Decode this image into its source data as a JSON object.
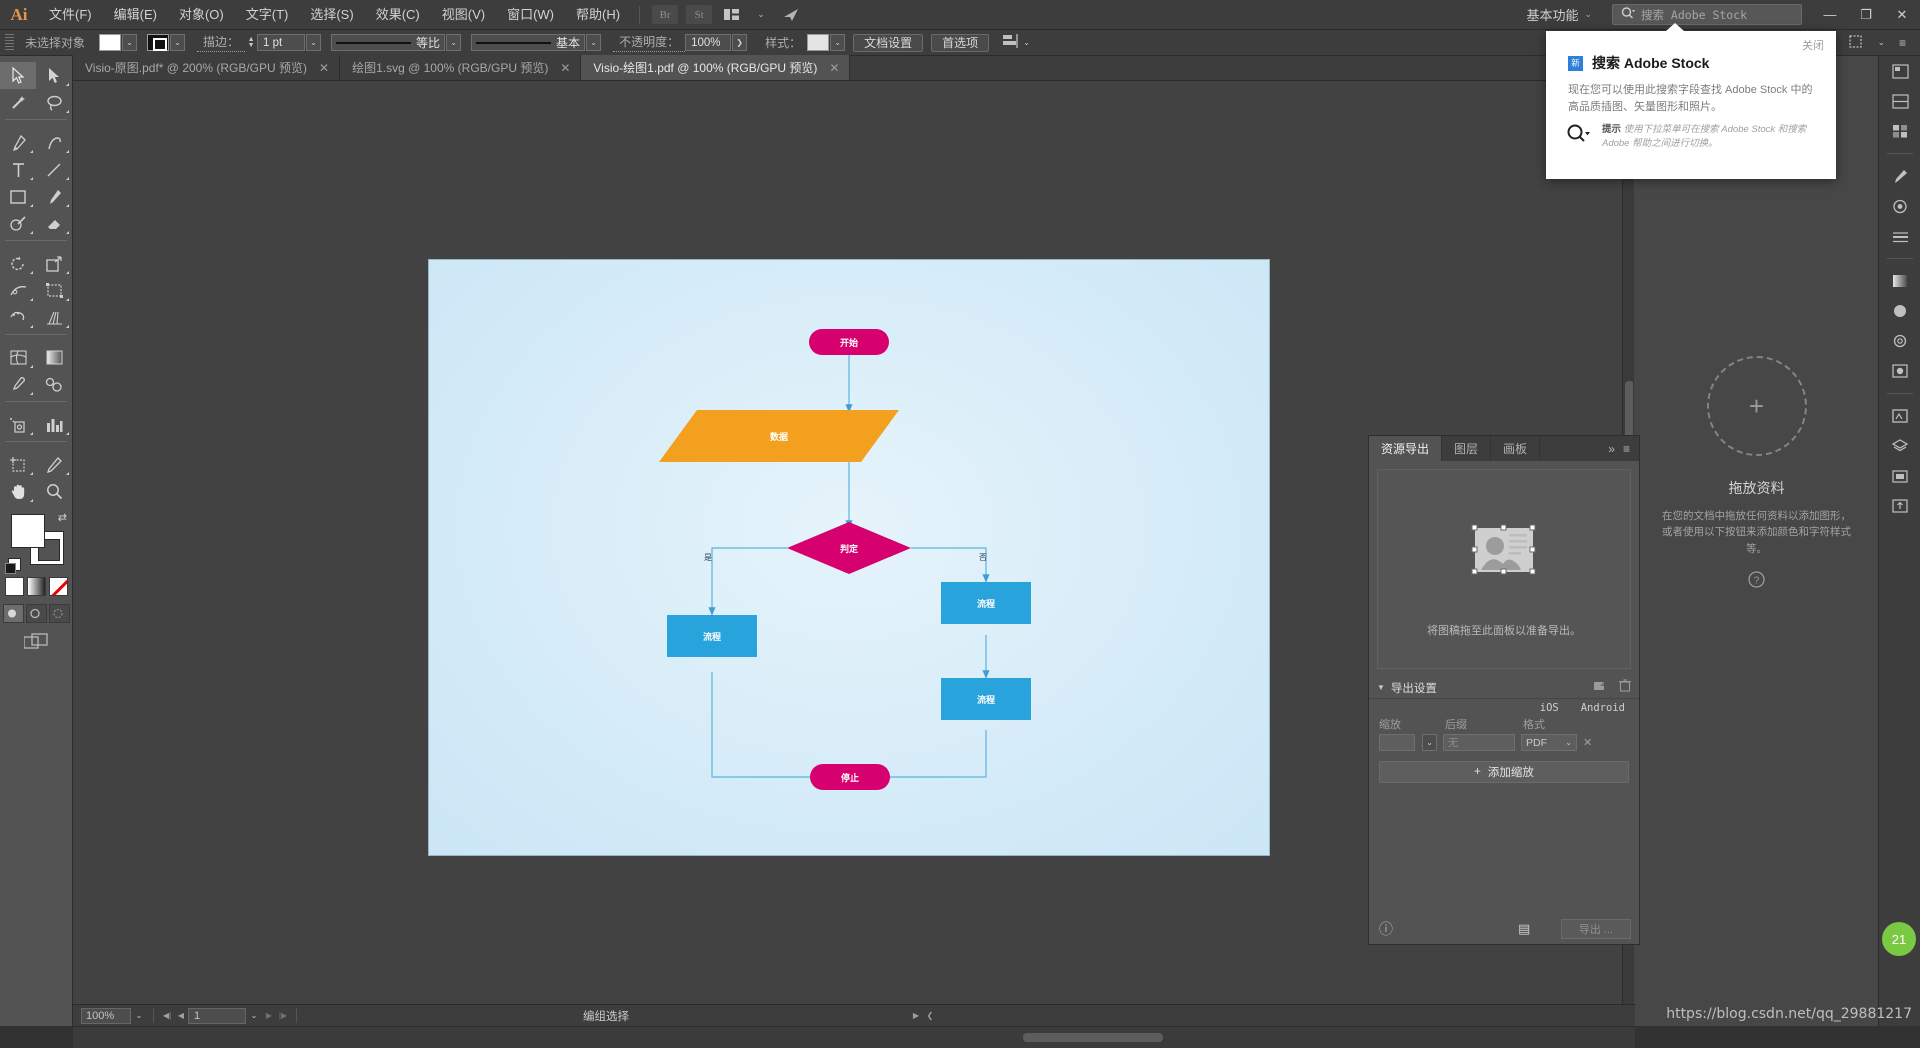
{
  "app": {
    "logo": "Ai",
    "title": "Adobe Illustrator"
  },
  "menubar": {
    "items": [
      {
        "label": "文件(F)"
      },
      {
        "label": "编辑(E)"
      },
      {
        "label": "对象(O)"
      },
      {
        "label": "文字(T)"
      },
      {
        "label": "选择(S)"
      },
      {
        "label": "效果(C)"
      },
      {
        "label": "视图(V)"
      },
      {
        "label": "窗口(W)"
      },
      {
        "label": "帮助(H)"
      }
    ],
    "bridge_label": "Br",
    "stock_label": "St",
    "workspace": "基本功能",
    "workspace_caret": "⌄",
    "stock_search_placeholder": "搜索 Adobe Stock",
    "window_minimize": "—",
    "window_restore": "❐",
    "window_close": "✕"
  },
  "controlbar": {
    "selection_status": "未选择对象",
    "stroke_label": "描边：",
    "stroke_width": "1 pt",
    "variable_width_profile": "等比",
    "brush_definition": "基本",
    "opacity_label": "不透明度：",
    "opacity_value": "100%",
    "opacity_arrow": "❯",
    "style_label": "样式：",
    "document_setup": "文档设置",
    "preferences": "首选项",
    "align_caret": "⌄"
  },
  "tabs": [
    {
      "label": "Visio-原图.pdf* @ 200% (RGB/GPU 预览)",
      "active": false,
      "close": "✕"
    },
    {
      "label": "绘图1.svg @ 100% (RGB/GPU 预览)",
      "active": false,
      "close": "✕"
    },
    {
      "label": "Visio-绘图1.pdf @ 100% (RGB/GPU 预览)",
      "active": true,
      "close": "✕"
    }
  ],
  "toolbar": {
    "tools": [
      "selection-tool",
      "direct-selection-tool",
      "magic-wand-tool",
      "lasso-tool",
      "pen-tool",
      "curvature-tool",
      "type-tool",
      "line-segment-tool",
      "rectangle-tool",
      "paintbrush-tool",
      "shape-builder-tool",
      "eraser-tool",
      "rotate-tool",
      "scale-tool",
      "width-tool",
      "free-transform-tool",
      "puppet-warp-tool",
      "perspective-grid-tool",
      "mesh-tool",
      "gradient-tool",
      "eyedropper-tool",
      "blend-tool",
      "symbol-sprayer-tool",
      "column-graph-tool",
      "artboard-tool",
      "slice-tool",
      "hand-tool",
      "zoom-tool"
    ],
    "fill_color": "#ffffff",
    "stroke_color": "#ffffff",
    "swap_icon": "⇄",
    "modes": [
      "color-mode",
      "gradient-mode",
      "none-mode"
    ],
    "draw_modes": [
      "draw-normal",
      "draw-behind",
      "draw-inside"
    ],
    "screen_mode": "change-screen-mode"
  },
  "canvas": {
    "artboard_bg": "#d9eef9",
    "flowchart": {
      "nodes": [
        {
          "id": "start",
          "label": "开始",
          "type": "terminator",
          "color": "#d6006f"
        },
        {
          "id": "data",
          "label": "数据",
          "type": "data",
          "color": "#f2a01e"
        },
        {
          "id": "decision",
          "label": "判定",
          "type": "decision",
          "color": "#d6006f"
        },
        {
          "id": "proc_yes",
          "label": "流程",
          "type": "process",
          "color": "#29a3dc"
        },
        {
          "id": "proc_no1",
          "label": "流程",
          "type": "process",
          "color": "#29a3dc"
        },
        {
          "id": "proc_no2",
          "label": "流程",
          "type": "process",
          "color": "#29a3dc"
        },
        {
          "id": "stop",
          "label": "停止",
          "type": "terminator",
          "color": "#d6006f"
        }
      ],
      "edge_labels": [
        {
          "id": "yes",
          "label": "是"
        },
        {
          "id": "no",
          "label": "否"
        }
      ],
      "connector_color": "#4aa8d8"
    }
  },
  "right_dock": {
    "icons": [
      "color-panel",
      "color-guide-panel",
      "swatches-panel",
      "brushes-panel",
      "symbols-panel",
      "stroke-panel",
      "gradient-panel",
      "transparency-panel",
      "appearance-panel",
      "graphic-styles-panel",
      "align-panel",
      "pathfinder-panel",
      "transform-panel",
      "libraries-panel",
      "layers-panel",
      "artboards-panel",
      "asset-export-panel"
    ],
    "drop_zone": {
      "title": "拖放资料",
      "description": "在您的文档中拖放任何资料以添加图形，或者使用以下按钮来添加颜色和字符样式等。",
      "plus": "+",
      "help": "?"
    }
  },
  "asset_export": {
    "tabs": [
      {
        "label": "资源导出",
        "active": true
      },
      {
        "label": "图层",
        "active": false
      },
      {
        "label": "画板",
        "active": false
      }
    ],
    "expand_icon": "»",
    "menu_icon": "≡",
    "drop_hint": "将图稿拖至此面板以准备导出。",
    "settings_title": "导出设置",
    "settings_arrow": "▼",
    "preset_ios": "iOS",
    "preset_android": "Android",
    "col_scale": "缩放",
    "col_suffix": "后缀",
    "col_format": "格式",
    "suffix_value": "无",
    "format_value": "PDF",
    "remove_icon": "✕",
    "add_scale": "添加缩放",
    "add_scale_plus": "+",
    "info_icon": "ⓘ",
    "list_icon": "▤",
    "export_button": "导出 ..."
  },
  "stock_popup": {
    "close": "关闭",
    "badge": "新",
    "title_cn": "搜索",
    "title_en": "Adobe Stock",
    "body": "现在您可以使用此搜索字段查找 Adobe Stock 中的高品质插图、矢量图形和照片。",
    "tip_label": "提示",
    "tip_text": "使用下拉菜单可在搜索 Adobe Stock 和搜索 Adobe 帮助之间进行切换。"
  },
  "statusbar": {
    "zoom": "100%",
    "zoom_caret": "⌄",
    "first": "◀|",
    "prev": "◀",
    "page": "1",
    "page_caret": "⌄",
    "next": "▶",
    "last": "|▶",
    "status_text": "编组选择",
    "status_arrow": "▶",
    "status_chevron": "❮"
  },
  "watermark": "https://blog.csdn.net/qq_29881217"
}
